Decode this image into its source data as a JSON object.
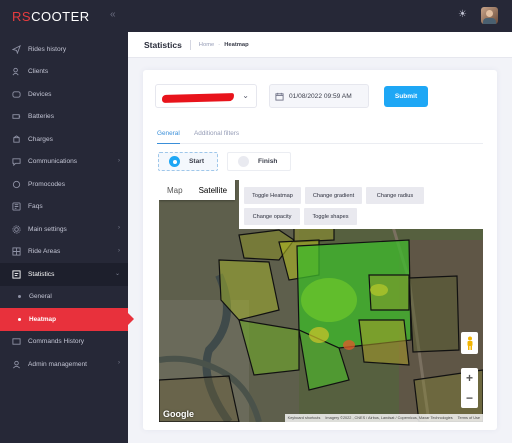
{
  "brand": {
    "logo_prefix": "RS",
    "logo_suffix": "COOTER"
  },
  "sidebar": {
    "items": [
      {
        "label": "Rides history",
        "icon": "send-icon"
      },
      {
        "label": "Clients",
        "icon": "users-icon"
      },
      {
        "label": "Devices",
        "icon": "device-icon"
      },
      {
        "label": "Batteries",
        "icon": "battery-icon"
      },
      {
        "label": "Charges",
        "icon": "charge-icon"
      },
      {
        "label": "Communications",
        "icon": "chat-icon"
      },
      {
        "label": "Promocodes",
        "icon": "tag-icon"
      },
      {
        "label": "Faqs",
        "icon": "help-icon"
      },
      {
        "label": "Main settings",
        "icon": "gear-icon"
      },
      {
        "label": "Ride Areas",
        "icon": "area-icon"
      },
      {
        "label": "Statistics",
        "icon": "chart-icon"
      },
      {
        "label": "General"
      },
      {
        "label": "Heatmap"
      },
      {
        "label": "Commands History",
        "icon": "terminal-icon"
      },
      {
        "label": "Admin management",
        "icon": "admin-icon"
      }
    ]
  },
  "header": {
    "title": "Statistics",
    "breadcrumb": [
      "Home",
      "Heatmap"
    ]
  },
  "filters": {
    "datetime": "01/08/2022 09:59 AM",
    "submit_label": "Submit"
  },
  "tabs": [
    "General",
    "Additional filters"
  ],
  "point_mode": {
    "options": [
      "Start",
      "Finish"
    ],
    "selected": "Start"
  },
  "map": {
    "map_types": [
      "Map",
      "Satellite"
    ],
    "selected_map_type": "Satellite",
    "buttons": [
      "Toggle Heatmap",
      "Change gradient",
      "Change radius",
      "Change opacity",
      "Toggle shapes"
    ],
    "zoom_in": "+",
    "zoom_out": "−",
    "google_logo": "Google",
    "attribution": [
      "Keyboard shortcuts",
      "Imagery ©2022 , CNES / Airbus, Landsat / Copernicus, Maxar Technologies",
      "Terms of Use"
    ]
  },
  "colors": {
    "sidebar_bg": "#262837",
    "active_item": "#e8313c",
    "submit": "#1ea7f5",
    "redaction": "#e8131b"
  }
}
